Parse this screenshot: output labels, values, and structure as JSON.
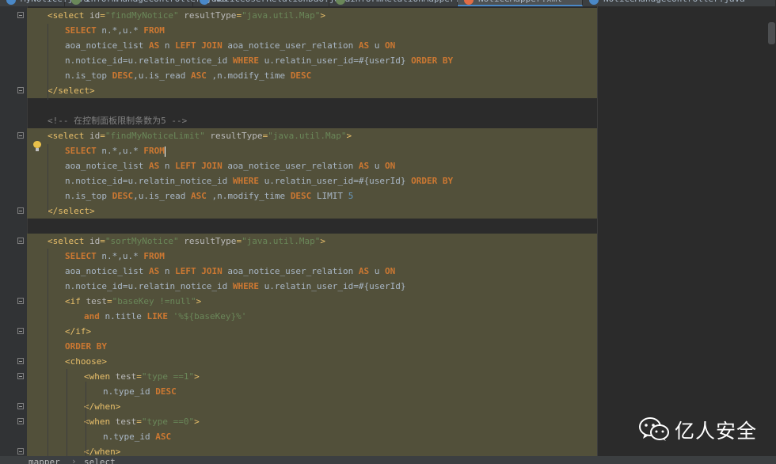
{
  "tabs": [
    {
      "label": "MyNotice.java",
      "color": "#4a88c7",
      "active": false
    },
    {
      "label": "InformManageController.java",
      "color": "#6a8759",
      "active": false
    },
    {
      "label": "NoticeUserRelationDao.java",
      "color": "#4a88c7",
      "active": false
    },
    {
      "label": "informRelationMapper.xml",
      "color": "#6a8759",
      "active": false
    },
    {
      "label": "NoticeMapper.xml",
      "color": "#e06c45",
      "active": true
    },
    {
      "label": "NoticeManageController.java",
      "color": "#4a88c7",
      "active": false
    }
  ],
  "code_lines": [
    [
      {
        "t": "<",
        "c": "tag"
      },
      {
        "t": "select ",
        "c": "tag"
      },
      {
        "t": "id",
        "c": "attr"
      },
      {
        "t": "=",
        "c": "tag"
      },
      {
        "t": "\"findMyNotice\"",
        "c": "str"
      },
      {
        "t": " resultType",
        "c": "attr"
      },
      {
        "t": "=",
        "c": "tag"
      },
      {
        "t": "\"java.util.Map\"",
        "c": "str"
      },
      {
        "t": ">",
        "c": "tag"
      }
    ],
    [
      {
        "t": "SELECT ",
        "c": "kw"
      },
      {
        "t": "n.*,u.* ",
        "c": "txt"
      },
      {
        "t": "FROM",
        "c": "kw"
      }
    ],
    [
      {
        "t": "aoa_notice_list ",
        "c": "txt"
      },
      {
        "t": "AS ",
        "c": "kw"
      },
      {
        "t": "n ",
        "c": "txt"
      },
      {
        "t": "LEFT JOIN ",
        "c": "kw"
      },
      {
        "t": "aoa_notice_user_relation ",
        "c": "txt"
      },
      {
        "t": "AS ",
        "c": "kw"
      },
      {
        "t": "u ",
        "c": "txt"
      },
      {
        "t": "ON",
        "c": "kw"
      }
    ],
    [
      {
        "t": "n.notice_id=u.relatin_notice_id ",
        "c": "txt"
      },
      {
        "t": "WHERE ",
        "c": "kw"
      },
      {
        "t": "u.relatin_user_id=#{userId} ",
        "c": "txt"
      },
      {
        "t": "ORDER BY",
        "c": "kw"
      }
    ],
    [
      {
        "t": "n.is_top ",
        "c": "txt"
      },
      {
        "t": "DESC",
        "c": "kw"
      },
      {
        "t": ",u.is_read ",
        "c": "txt"
      },
      {
        "t": "ASC ",
        "c": "kw"
      },
      {
        "t": ",n.modify_time ",
        "c": "txt"
      },
      {
        "t": "DESC",
        "c": "kw"
      }
    ],
    [
      {
        "t": "</select>",
        "c": "tag"
      }
    ],
    [],
    [
      {
        "t": "<!-- 在控制面板限制条数为5 -->",
        "c": "cmt"
      }
    ],
    [
      {
        "t": "<select ",
        "c": "tag"
      },
      {
        "t": "id",
        "c": "attr"
      },
      {
        "t": "=",
        "c": "tag"
      },
      {
        "t": "\"findMyNoticeLimit\"",
        "c": "str"
      },
      {
        "t": " resultType",
        "c": "attr"
      },
      {
        "t": "=",
        "c": "tag"
      },
      {
        "t": "\"java.util.Map\"",
        "c": "str"
      },
      {
        "t": ">",
        "c": "tag"
      }
    ],
    [
      {
        "t": "SELECT ",
        "c": "kw"
      },
      {
        "t": "n.*,u.* ",
        "c": "txt"
      },
      {
        "t": "FROM",
        "c": "kw"
      }
    ],
    [
      {
        "t": "aoa_notice_list ",
        "c": "txt"
      },
      {
        "t": "AS ",
        "c": "kw"
      },
      {
        "t": "n ",
        "c": "txt"
      },
      {
        "t": "LEFT JOIN ",
        "c": "kw"
      },
      {
        "t": "aoa_notice_user_relation ",
        "c": "txt"
      },
      {
        "t": "AS ",
        "c": "kw"
      },
      {
        "t": "u ",
        "c": "txt"
      },
      {
        "t": "ON",
        "c": "kw"
      }
    ],
    [
      {
        "t": "n.notice_id=u.relatin_notice_id ",
        "c": "txt"
      },
      {
        "t": "WHERE ",
        "c": "kw"
      },
      {
        "t": "u.relatin_user_id=#{userId} ",
        "c": "txt"
      },
      {
        "t": "ORDER BY",
        "c": "kw"
      }
    ],
    [
      {
        "t": "n.is_top ",
        "c": "txt"
      },
      {
        "t": "DESC",
        "c": "kw"
      },
      {
        "t": ",u.is_read ",
        "c": "txt"
      },
      {
        "t": "ASC ",
        "c": "kw"
      },
      {
        "t": ",n.modify_time ",
        "c": "txt"
      },
      {
        "t": "DESC ",
        "c": "kw"
      },
      {
        "t": "LIMIT ",
        "c": "txt"
      },
      {
        "t": "5",
        "c": "num"
      }
    ],
    [
      {
        "t": "</select>",
        "c": "tag"
      }
    ],
    [],
    [
      {
        "t": "<select ",
        "c": "tag"
      },
      {
        "t": "id",
        "c": "attr"
      },
      {
        "t": "=",
        "c": "tag"
      },
      {
        "t": "\"sortMyNotice\"",
        "c": "str"
      },
      {
        "t": " resultType",
        "c": "attr"
      },
      {
        "t": "=",
        "c": "tag"
      },
      {
        "t": "\"java.util.Map\"",
        "c": "str"
      },
      {
        "t": ">",
        "c": "tag"
      }
    ],
    [
      {
        "t": "SELECT ",
        "c": "kw"
      },
      {
        "t": "n.*,u.* ",
        "c": "txt"
      },
      {
        "t": "FROM",
        "c": "kw"
      }
    ],
    [
      {
        "t": "aoa_notice_list ",
        "c": "txt"
      },
      {
        "t": "AS ",
        "c": "kw"
      },
      {
        "t": "n ",
        "c": "txt"
      },
      {
        "t": "LEFT JOIN ",
        "c": "kw"
      },
      {
        "t": "aoa_notice_user_relation ",
        "c": "txt"
      },
      {
        "t": "AS ",
        "c": "kw"
      },
      {
        "t": "u ",
        "c": "txt"
      },
      {
        "t": "ON",
        "c": "kw"
      }
    ],
    [
      {
        "t": "n.notice_id=u.relatin_notice_id ",
        "c": "txt"
      },
      {
        "t": "WHERE ",
        "c": "kw"
      },
      {
        "t": "u.relatin_user_id=#{userId}",
        "c": "txt"
      }
    ],
    [
      {
        "t": "<if ",
        "c": "tag"
      },
      {
        "t": "test",
        "c": "attr"
      },
      {
        "t": "=",
        "c": "tag"
      },
      {
        "t": "\"baseKey !=null\"",
        "c": "str"
      },
      {
        "t": ">",
        "c": "tag"
      }
    ],
    [
      {
        "t": "and ",
        "c": "kw"
      },
      {
        "t": "n.title ",
        "c": "txt"
      },
      {
        "t": "LIKE ",
        "c": "kw"
      },
      {
        "t": "'%${baseKey}%'",
        "c": "str"
      }
    ],
    [
      {
        "t": "</if>",
        "c": "tag"
      }
    ],
    [
      {
        "t": "ORDER BY",
        "c": "kw"
      }
    ],
    [
      {
        "t": "<choose>",
        "c": "tag"
      }
    ],
    [
      {
        "t": "<when ",
        "c": "tag"
      },
      {
        "t": "test",
        "c": "attr"
      },
      {
        "t": "=",
        "c": "tag"
      },
      {
        "t": "\"type ==1\"",
        "c": "str"
      },
      {
        "t": ">",
        "c": "tag"
      }
    ],
    [
      {
        "t": "n.type_id ",
        "c": "txt"
      },
      {
        "t": "DESC",
        "c": "kw"
      }
    ],
    [
      {
        "t": "</when>",
        "c": "tag"
      }
    ],
    [
      {
        "t": "<when ",
        "c": "tag"
      },
      {
        "t": "test",
        "c": "attr"
      },
      {
        "t": "=",
        "c": "tag"
      },
      {
        "t": "\"type ==0\"",
        "c": "str"
      },
      {
        "t": ">",
        "c": "tag"
      }
    ],
    [
      {
        "t": "n.type_id ",
        "c": "txt"
      },
      {
        "t": "ASC",
        "c": "kw"
      }
    ],
    [
      {
        "t": "</when>",
        "c": "tag"
      }
    ]
  ],
  "breadcrumb": [
    "mapper",
    "select"
  ],
  "watermark": {
    "text": "亿人安全"
  }
}
